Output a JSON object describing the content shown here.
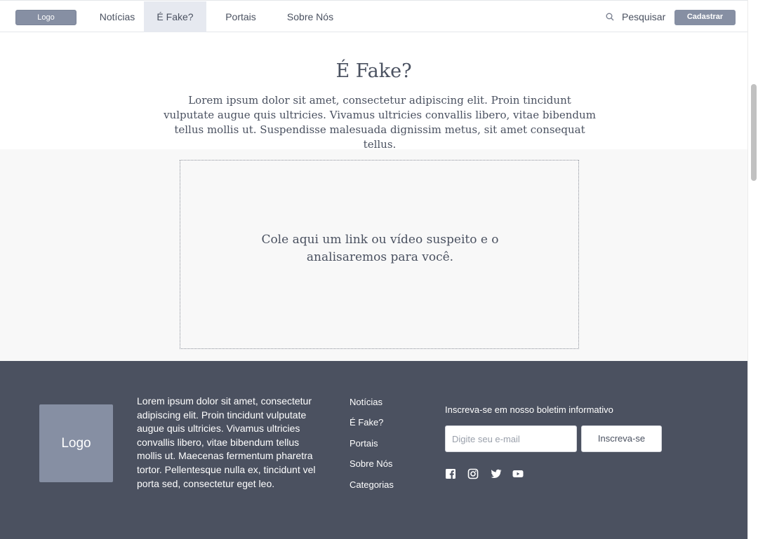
{
  "header": {
    "logo_label": "Logo",
    "nav": [
      {
        "label": "Notícias",
        "active": false
      },
      {
        "label": "É Fake?",
        "active": true
      },
      {
        "label": "Portais",
        "active": false
      },
      {
        "label": "Sobre Nós",
        "active": false
      }
    ],
    "search_label": "Pesquisar",
    "search_icon": "search-icon",
    "cta_label": "Cadastrar"
  },
  "hero": {
    "title": "É Fake?",
    "text": "Lorem ipsum dolor sit amet, consectetur adipiscing elit. Proin tincidunt vulputate augue quis ultricies. Vivamus ultricies convallis libero, vitae bibendum tellus mollis ut. Suspendisse malesuada dignissim metus, sit amet consequat tellus."
  },
  "dropzone": {
    "text": "Cole aqui um link ou vídeo suspeito e o analisaremos para você."
  },
  "footer": {
    "logo_label": "Logo",
    "about": "Lorem ipsum dolor sit amet, consectetur adipiscing elit. Proin tincidunt vulputate augue quis ultricies. Vivamus ultricies convallis libero, vitae bibendum tellus mollis ut. Maecenas fermentum pharetra tortor. Pellentesque nulla ex, tincidunt vel porta sed, consectetur eget leo.",
    "links": [
      "Notícias",
      "É Fake?",
      "Portais",
      "Sobre Nós",
      "Categorias"
    ],
    "newsletter_label": "Inscreva-se em nosso boletim informativo",
    "email_placeholder": "Digite seu e-mail",
    "email_value": "",
    "subscribe_label": "Inscreva-se",
    "social_icons": [
      "facebook-icon",
      "instagram-icon",
      "twitter-icon",
      "youtube-icon"
    ]
  },
  "colors": {
    "primary": "#868fa3",
    "footer_bg": "#4b5160",
    "text": "#4a5160",
    "active_nav_bg": "#e6e9f0",
    "section_bg": "#f8f8f8"
  }
}
